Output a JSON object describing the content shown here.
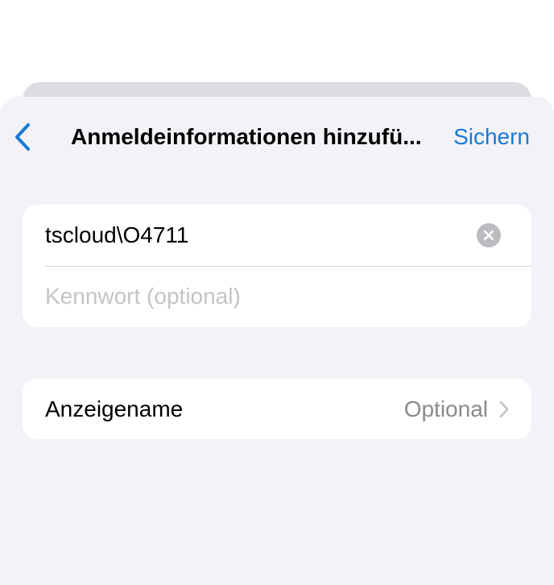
{
  "navbar": {
    "title": "Anmeldeinformationen hinzufü...",
    "save_label": "Sichern",
    "accent_color": "#1a7ad4"
  },
  "credentials": {
    "username_value": "tscloud\\O4711",
    "password_placeholder": "Kennwort (optional)"
  },
  "display_name": {
    "label": "Anzeigename",
    "value": "Optional"
  },
  "icons": {
    "back": "chevron-left-icon",
    "clear": "clear-circle-icon",
    "disclosure": "chevron-right-icon"
  }
}
